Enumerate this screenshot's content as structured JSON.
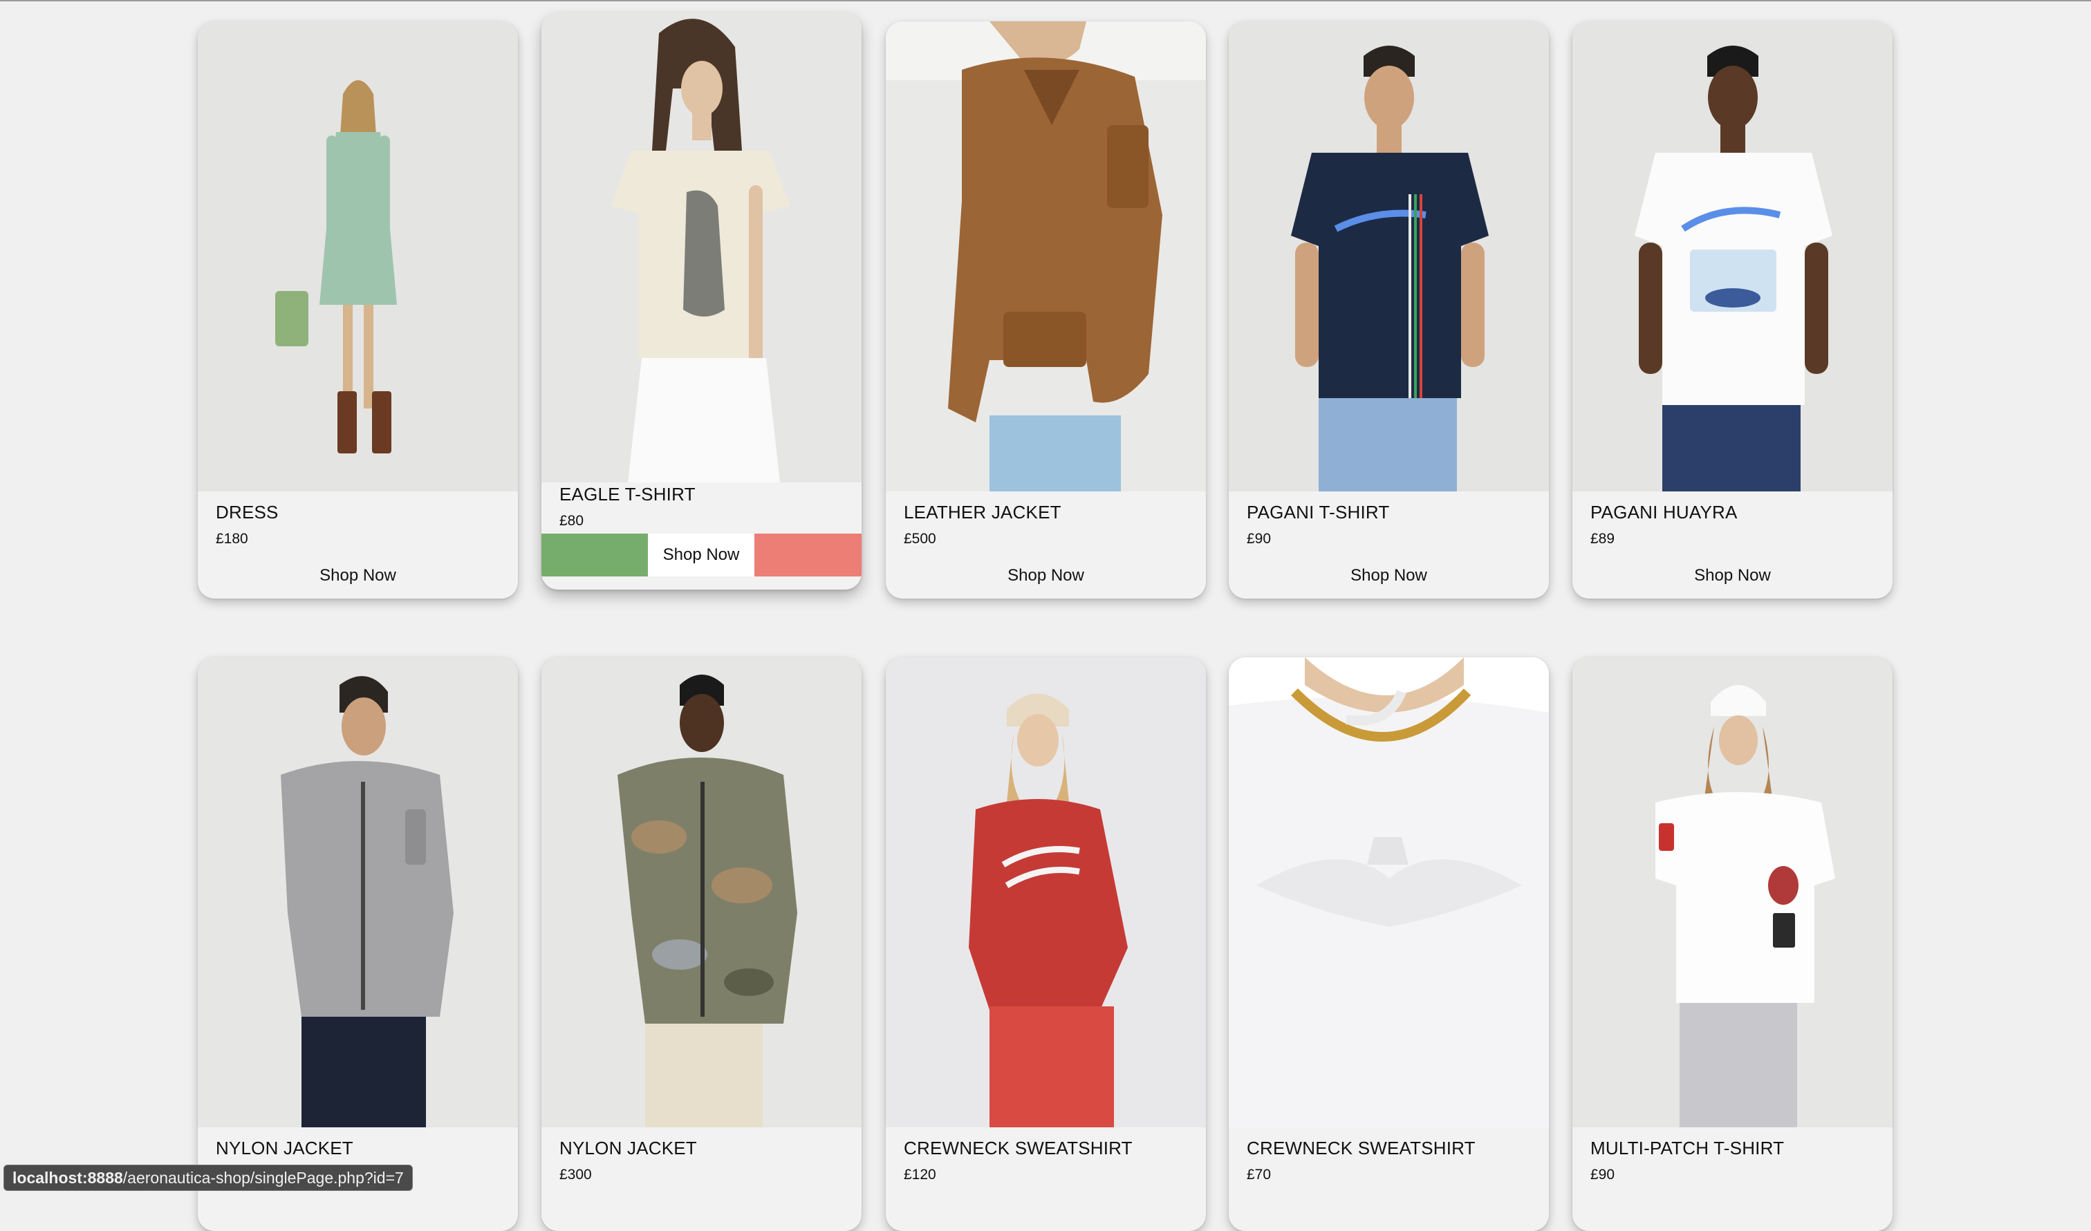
{
  "theme": {
    "page_bg": "#f0f0f0",
    "card_bg": "#f2f2f2",
    "hover_green": "#77ad6c",
    "hover_red": "#ec7e76"
  },
  "products": [
    {
      "name": "DRESS",
      "price": "£180",
      "cta": "Shop Now",
      "image": "woman-green-shirt-dress-icon"
    },
    {
      "name": "EAGLE T-SHIRT",
      "price": "£80",
      "cta": "Shop Now",
      "image": "woman-cream-eagle-tshirt-icon"
    },
    {
      "name": "LEATHER JACKET",
      "price": "£500",
      "cta": "Shop Now",
      "image": "woman-brown-leather-jacket-icon"
    },
    {
      "name": "PAGANI T-SHIRT",
      "price": "£90",
      "cta": "Shop Now",
      "image": "man-navy-pagani-tshirt-icon"
    },
    {
      "name": "PAGANI HUAYRA",
      "price": "£89",
      "cta": "Shop Now",
      "image": "man-white-huayra-tshirt-icon"
    },
    {
      "name": "NYLON JACKET",
      "price": "",
      "cta": "",
      "image": "man-grey-nylon-jacket-icon"
    },
    {
      "name": "NYLON JACKET",
      "price": "£300",
      "cta": "",
      "image": "man-camo-nylon-jacket-icon"
    },
    {
      "name": "CREWNECK SWEATSHIRT",
      "price": "£120",
      "cta": "",
      "image": "woman-red-sweatshirt-icon"
    },
    {
      "name": "CREWNECK SWEATSHIRT",
      "price": "£70",
      "cta": "",
      "image": "woman-white-sweatshirt-icon"
    },
    {
      "name": "MULTI-PATCH T-SHIRT",
      "price": "£90",
      "cta": "",
      "image": "woman-white-patch-tshirt-icon"
    }
  ],
  "statusbar": {
    "host": "localhost:8888",
    "path": "/aeronautica-shop/singlePage.php?id=7"
  }
}
